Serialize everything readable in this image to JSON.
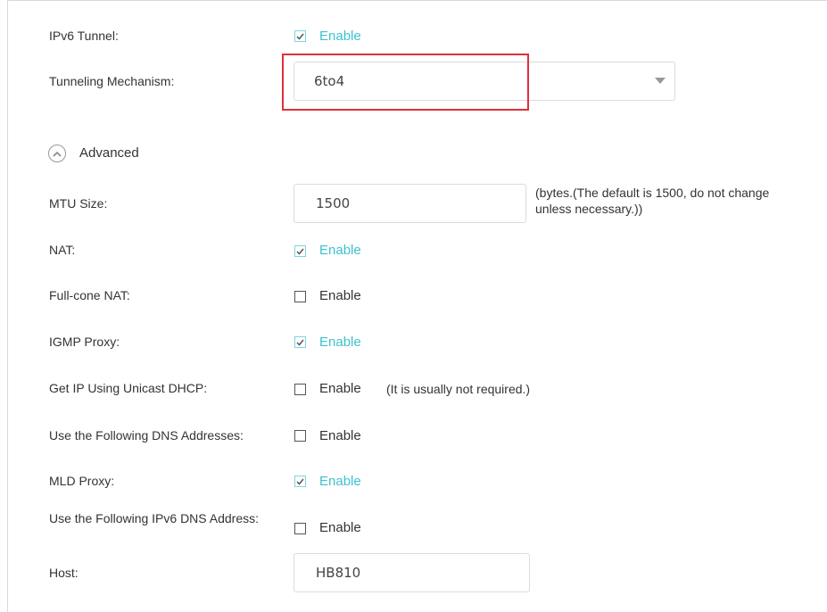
{
  "rows": {
    "ipv6_tunnel": {
      "label": "IPv6 Tunnel:",
      "option": "Enable",
      "checked": true
    },
    "tunneling_mechanism": {
      "label": "Tunneling Mechanism:",
      "value": "6to4"
    },
    "advanced": {
      "label": "Advanced"
    },
    "mtu": {
      "label": "MTU Size:",
      "value": "1500",
      "note": "(bytes.(The default is 1500, do not change unless necessary.))"
    },
    "nat": {
      "label": "NAT:",
      "option": "Enable",
      "checked": true
    },
    "full_cone_nat": {
      "label": "Full-cone NAT:",
      "option": "Enable",
      "checked": false
    },
    "igmp_proxy": {
      "label": "IGMP Proxy:",
      "option": "Enable",
      "checked": true
    },
    "unicast_dhcp": {
      "label": "Get IP Using Unicast DHCP:",
      "option": "Enable",
      "checked": false,
      "note": "(It is usually not required.)"
    },
    "dns_addresses": {
      "label": "Use the Following DNS Addresses:",
      "option": "Enable",
      "checked": false
    },
    "mld_proxy": {
      "label": "MLD Proxy:",
      "option": "Enable",
      "checked": true
    },
    "ipv6_dns": {
      "label": "Use the Following IPv6 DNS Address:",
      "option": "Enable",
      "checked": false
    },
    "host": {
      "label": "Host:",
      "value": "HB810"
    }
  },
  "colors": {
    "accent": "#3ec1cf",
    "highlight": "#e0303a"
  },
  "icons": {
    "advanced": "chevron-up-circle-icon",
    "dropdown": "caret-down-icon",
    "check": "checkmark-icon"
  }
}
